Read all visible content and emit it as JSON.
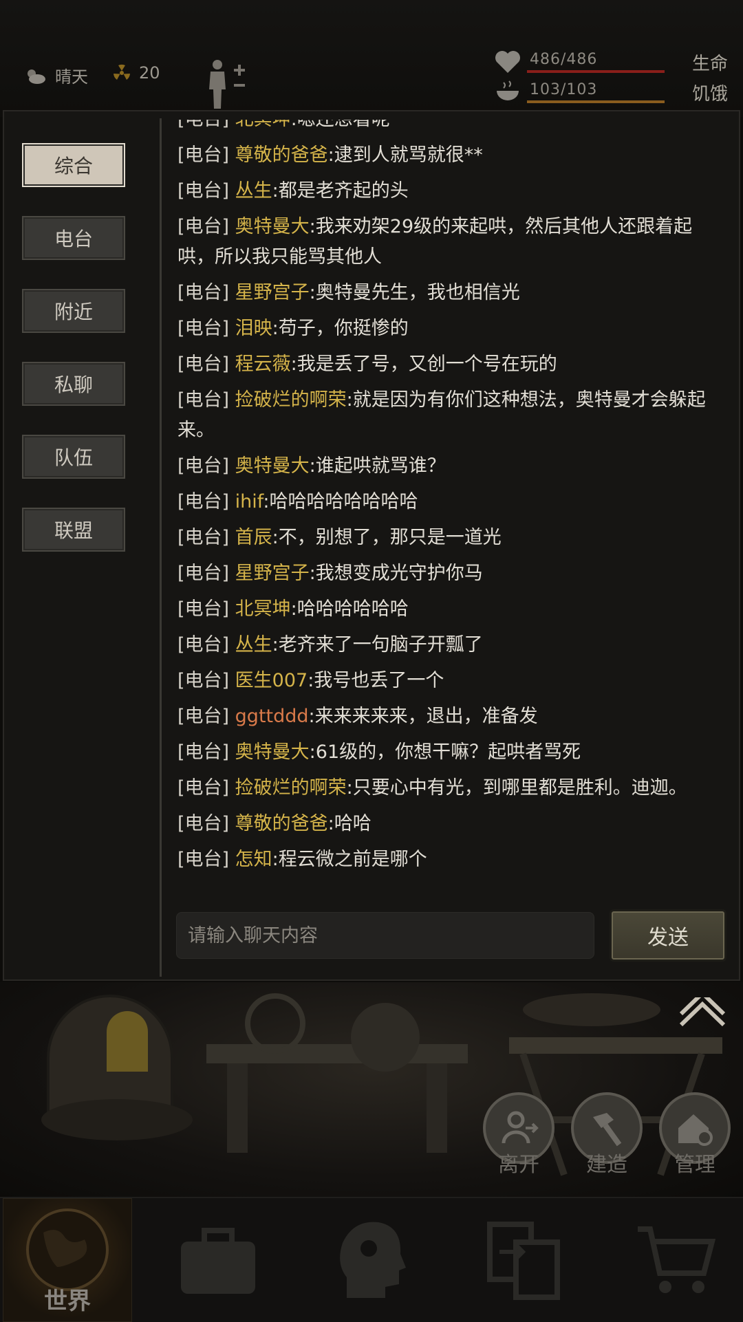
{
  "hud": {
    "weather": "晴天",
    "radiation": "20",
    "hp": "486/486",
    "hp_label": "生命",
    "hunger": "103/103",
    "hunger_label": "饥饿"
  },
  "tabs": [
    "综合",
    "电台",
    "附近",
    "私聊",
    "队伍",
    "联盟"
  ],
  "active_tab": "综合",
  "messages": [
    {
      "channel": "[电台]",
      "name": "北冥坤",
      "text": ":嗯还想看呢"
    },
    {
      "channel": "[电台]",
      "name": "尊敬的爸爸",
      "text": ":逮到人就骂就很**"
    },
    {
      "channel": "[电台]",
      "name": "丛生",
      "text": ":都是老齐起的头"
    },
    {
      "channel": "[电台]",
      "name": "奥特曼大",
      "text": ":我来劝架29级的来起哄，然后其他人还跟着起哄，所以我只能骂其他人"
    },
    {
      "channel": "[电台]",
      "name": "星野宫子",
      "text": ":奥特曼先生，我也相信光"
    },
    {
      "channel": "[电台]",
      "name": "泪映",
      "text": ":苟子，你挺惨的"
    },
    {
      "channel": "[电台]",
      "name": "程云薇",
      "text": ":我是丢了号，又创一个号在玩的"
    },
    {
      "channel": "[电台]",
      "name": "捡破烂的啊荣",
      "text": ":就是因为有你们这种想法，奥特曼才会躲起来。"
    },
    {
      "channel": "[电台]",
      "name": "奥特曼大",
      "text": ":谁起哄就骂谁？"
    },
    {
      "channel": "[电台]",
      "name": "ihif",
      "text": ":哈哈哈哈哈哈哈哈"
    },
    {
      "channel": "[电台]",
      "name": "首辰",
      "text": ":不，别想了，那只是一道光"
    },
    {
      "channel": "[电台]",
      "name": "星野宫子",
      "text": ":我想变成光守护你马"
    },
    {
      "channel": "[电台]",
      "name": "北冥坤",
      "text": ":哈哈哈哈哈哈"
    },
    {
      "channel": "[电台]",
      "name": "丛生",
      "text": ":老齐来了一句脑子开瓢了"
    },
    {
      "channel": "[电台]",
      "name": "医生007",
      "text": ":我号也丢了一个"
    },
    {
      "channel": "[电台]",
      "name": "ggttddd",
      "text": ":来来来来来，退出，准备发",
      "alt": true
    },
    {
      "channel": "[电台]",
      "name": "奥特曼大",
      "text": ":61级的，你想干嘛？起哄者骂死"
    },
    {
      "channel": "[电台]",
      "name": "捡破烂的啊荣",
      "text": ":只要心中有光，到哪里都是胜利。迪迦。"
    },
    {
      "channel": "[电台]",
      "name": "尊敬的爸爸",
      "text": ":哈哈"
    },
    {
      "channel": "[电台]",
      "name": "怎知",
      "text": ":程云微之前是哪个"
    }
  ],
  "chat": {
    "placeholder": "请输入聊天内容",
    "send_label": "发送"
  },
  "actions": {
    "leave": "离开",
    "build": "建造",
    "manage": "管理"
  },
  "nav": {
    "world": "世界"
  }
}
